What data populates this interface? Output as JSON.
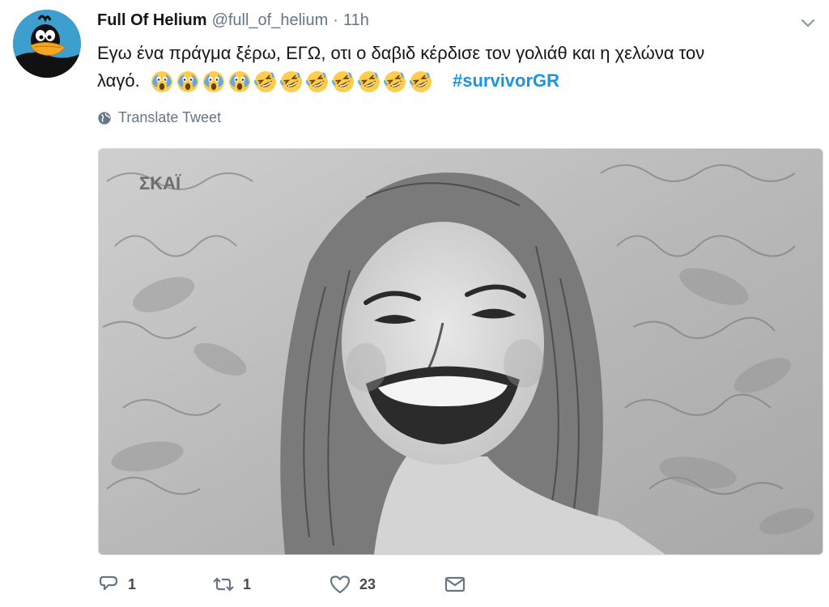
{
  "tweet": {
    "display_name": "Full Of Helium",
    "handle": "@full_of_helium",
    "separator": "·",
    "timestamp": "11h",
    "text_line1": "Εγω ένα πράγμα ξέρω, ΕΓΩ, οτι ο δαβιδ κέρδισε τον  γολιάθ και η χελώνα τον",
    "text_line2": "λαγό.",
    "emojis": [
      "scream-emoji",
      "scream-emoji",
      "scream-emoji",
      "scream-emoji",
      "rofl-emoji",
      "rofl-emoji",
      "rofl-emoji",
      "rofl-emoji",
      "rofl-emoji",
      "rofl-emoji",
      "rofl-emoji"
    ],
    "hashtag": "#survivorGR",
    "translate_label": "Translate Tweet",
    "media_watermark": "ΣΚΑΪ",
    "actions": {
      "reply_count": "1",
      "retweet_count": "1",
      "like_count": "23"
    }
  },
  "colors": {
    "link": "#1b95e0",
    "secondary_text": "#657786",
    "primary_text": "#14171a",
    "avatar_bg": "#3d9fce"
  }
}
